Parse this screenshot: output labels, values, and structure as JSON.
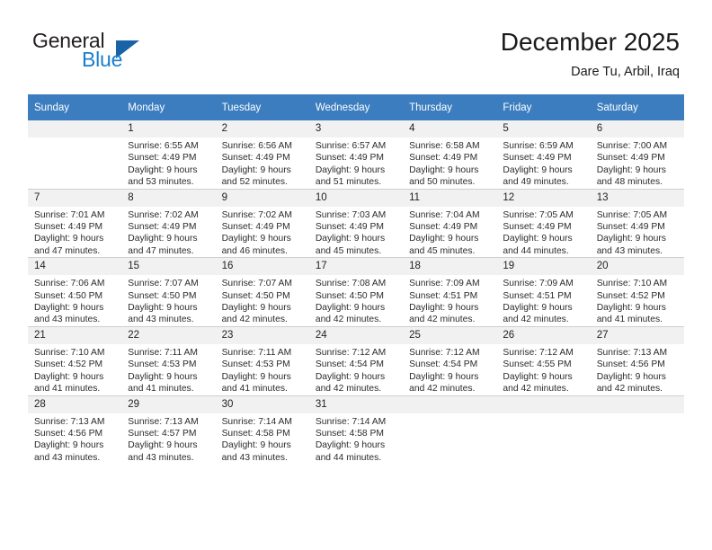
{
  "brand": {
    "word1": "General",
    "word2": "Blue",
    "triangle_color": "#1763a6"
  },
  "header": {
    "month_title": "December 2025",
    "location": "Dare Tu, Arbil, Iraq",
    "header_bg": "#3b7dbf"
  },
  "weekdays": [
    "Sunday",
    "Monday",
    "Tuesday",
    "Wednesday",
    "Thursday",
    "Friday",
    "Saturday"
  ],
  "weeks": [
    [
      {
        "day": "",
        "lines": []
      },
      {
        "day": "1",
        "lines": [
          "Sunrise: 6:55 AM",
          "Sunset: 4:49 PM",
          "Daylight: 9 hours",
          "and 53 minutes."
        ]
      },
      {
        "day": "2",
        "lines": [
          "Sunrise: 6:56 AM",
          "Sunset: 4:49 PM",
          "Daylight: 9 hours",
          "and 52 minutes."
        ]
      },
      {
        "day": "3",
        "lines": [
          "Sunrise: 6:57 AM",
          "Sunset: 4:49 PM",
          "Daylight: 9 hours",
          "and 51 minutes."
        ]
      },
      {
        "day": "4",
        "lines": [
          "Sunrise: 6:58 AM",
          "Sunset: 4:49 PM",
          "Daylight: 9 hours",
          "and 50 minutes."
        ]
      },
      {
        "day": "5",
        "lines": [
          "Sunrise: 6:59 AM",
          "Sunset: 4:49 PM",
          "Daylight: 9 hours",
          "and 49 minutes."
        ]
      },
      {
        "day": "6",
        "lines": [
          "Sunrise: 7:00 AM",
          "Sunset: 4:49 PM",
          "Daylight: 9 hours",
          "and 48 minutes."
        ]
      }
    ],
    [
      {
        "day": "7",
        "lines": [
          "Sunrise: 7:01 AM",
          "Sunset: 4:49 PM",
          "Daylight: 9 hours",
          "and 47 minutes."
        ]
      },
      {
        "day": "8",
        "lines": [
          "Sunrise: 7:02 AM",
          "Sunset: 4:49 PM",
          "Daylight: 9 hours",
          "and 47 minutes."
        ]
      },
      {
        "day": "9",
        "lines": [
          "Sunrise: 7:02 AM",
          "Sunset: 4:49 PM",
          "Daylight: 9 hours",
          "and 46 minutes."
        ]
      },
      {
        "day": "10",
        "lines": [
          "Sunrise: 7:03 AM",
          "Sunset: 4:49 PM",
          "Daylight: 9 hours",
          "and 45 minutes."
        ]
      },
      {
        "day": "11",
        "lines": [
          "Sunrise: 7:04 AM",
          "Sunset: 4:49 PM",
          "Daylight: 9 hours",
          "and 45 minutes."
        ]
      },
      {
        "day": "12",
        "lines": [
          "Sunrise: 7:05 AM",
          "Sunset: 4:49 PM",
          "Daylight: 9 hours",
          "and 44 minutes."
        ]
      },
      {
        "day": "13",
        "lines": [
          "Sunrise: 7:05 AM",
          "Sunset: 4:49 PM",
          "Daylight: 9 hours",
          "and 43 minutes."
        ]
      }
    ],
    [
      {
        "day": "14",
        "lines": [
          "Sunrise: 7:06 AM",
          "Sunset: 4:50 PM",
          "Daylight: 9 hours",
          "and 43 minutes."
        ]
      },
      {
        "day": "15",
        "lines": [
          "Sunrise: 7:07 AM",
          "Sunset: 4:50 PM",
          "Daylight: 9 hours",
          "and 43 minutes."
        ]
      },
      {
        "day": "16",
        "lines": [
          "Sunrise: 7:07 AM",
          "Sunset: 4:50 PM",
          "Daylight: 9 hours",
          "and 42 minutes."
        ]
      },
      {
        "day": "17",
        "lines": [
          "Sunrise: 7:08 AM",
          "Sunset: 4:50 PM",
          "Daylight: 9 hours",
          "and 42 minutes."
        ]
      },
      {
        "day": "18",
        "lines": [
          "Sunrise: 7:09 AM",
          "Sunset: 4:51 PM",
          "Daylight: 9 hours",
          "and 42 minutes."
        ]
      },
      {
        "day": "19",
        "lines": [
          "Sunrise: 7:09 AM",
          "Sunset: 4:51 PM",
          "Daylight: 9 hours",
          "and 42 minutes."
        ]
      },
      {
        "day": "20",
        "lines": [
          "Sunrise: 7:10 AM",
          "Sunset: 4:52 PM",
          "Daylight: 9 hours",
          "and 41 minutes."
        ]
      }
    ],
    [
      {
        "day": "21",
        "lines": [
          "Sunrise: 7:10 AM",
          "Sunset: 4:52 PM",
          "Daylight: 9 hours",
          "and 41 minutes."
        ]
      },
      {
        "day": "22",
        "lines": [
          "Sunrise: 7:11 AM",
          "Sunset: 4:53 PM",
          "Daylight: 9 hours",
          "and 41 minutes."
        ]
      },
      {
        "day": "23",
        "lines": [
          "Sunrise: 7:11 AM",
          "Sunset: 4:53 PM",
          "Daylight: 9 hours",
          "and 41 minutes."
        ]
      },
      {
        "day": "24",
        "lines": [
          "Sunrise: 7:12 AM",
          "Sunset: 4:54 PM",
          "Daylight: 9 hours",
          "and 42 minutes."
        ]
      },
      {
        "day": "25",
        "lines": [
          "Sunrise: 7:12 AM",
          "Sunset: 4:54 PM",
          "Daylight: 9 hours",
          "and 42 minutes."
        ]
      },
      {
        "day": "26",
        "lines": [
          "Sunrise: 7:12 AM",
          "Sunset: 4:55 PM",
          "Daylight: 9 hours",
          "and 42 minutes."
        ]
      },
      {
        "day": "27",
        "lines": [
          "Sunrise: 7:13 AM",
          "Sunset: 4:56 PM",
          "Daylight: 9 hours",
          "and 42 minutes."
        ]
      }
    ],
    [
      {
        "day": "28",
        "lines": [
          "Sunrise: 7:13 AM",
          "Sunset: 4:56 PM",
          "Daylight: 9 hours",
          "and 43 minutes."
        ]
      },
      {
        "day": "29",
        "lines": [
          "Sunrise: 7:13 AM",
          "Sunset: 4:57 PM",
          "Daylight: 9 hours",
          "and 43 minutes."
        ]
      },
      {
        "day": "30",
        "lines": [
          "Sunrise: 7:14 AM",
          "Sunset: 4:58 PM",
          "Daylight: 9 hours",
          "and 43 minutes."
        ]
      },
      {
        "day": "31",
        "lines": [
          "Sunrise: 7:14 AM",
          "Sunset: 4:58 PM",
          "Daylight: 9 hours",
          "and 44 minutes."
        ]
      },
      {
        "day": "",
        "lines": []
      },
      {
        "day": "",
        "lines": []
      },
      {
        "day": "",
        "lines": []
      }
    ]
  ]
}
